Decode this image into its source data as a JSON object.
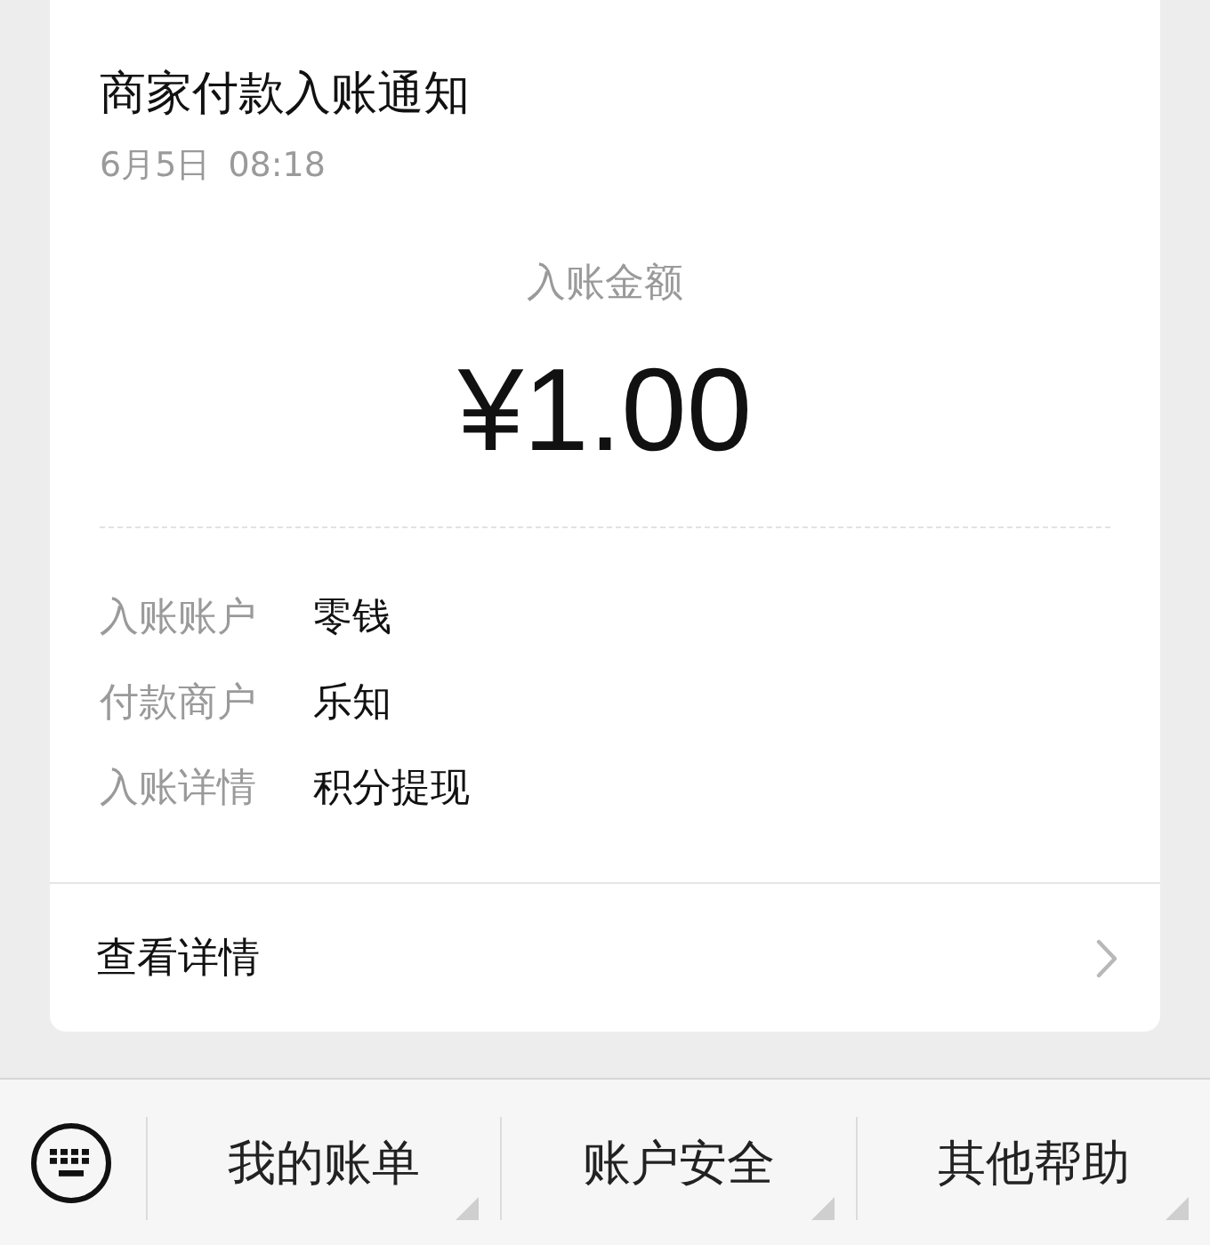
{
  "notification": {
    "title": "商家付款入账通知",
    "time": "6月5日 08:18",
    "amount_label": "入账金额",
    "amount": "¥1.00",
    "details": [
      {
        "label": "入账账户",
        "value": "零钱"
      },
      {
        "label": "付款商户",
        "value": "乐知"
      },
      {
        "label": "入账详情",
        "value": "积分提现"
      }
    ],
    "link": {
      "label": "查看详情"
    }
  },
  "bottom_menu": {
    "items": [
      {
        "label": "我的账单",
        "submenu": true
      },
      {
        "label": "账户安全",
        "submenu": true
      },
      {
        "label": "其他帮助",
        "submenu": true
      }
    ]
  }
}
